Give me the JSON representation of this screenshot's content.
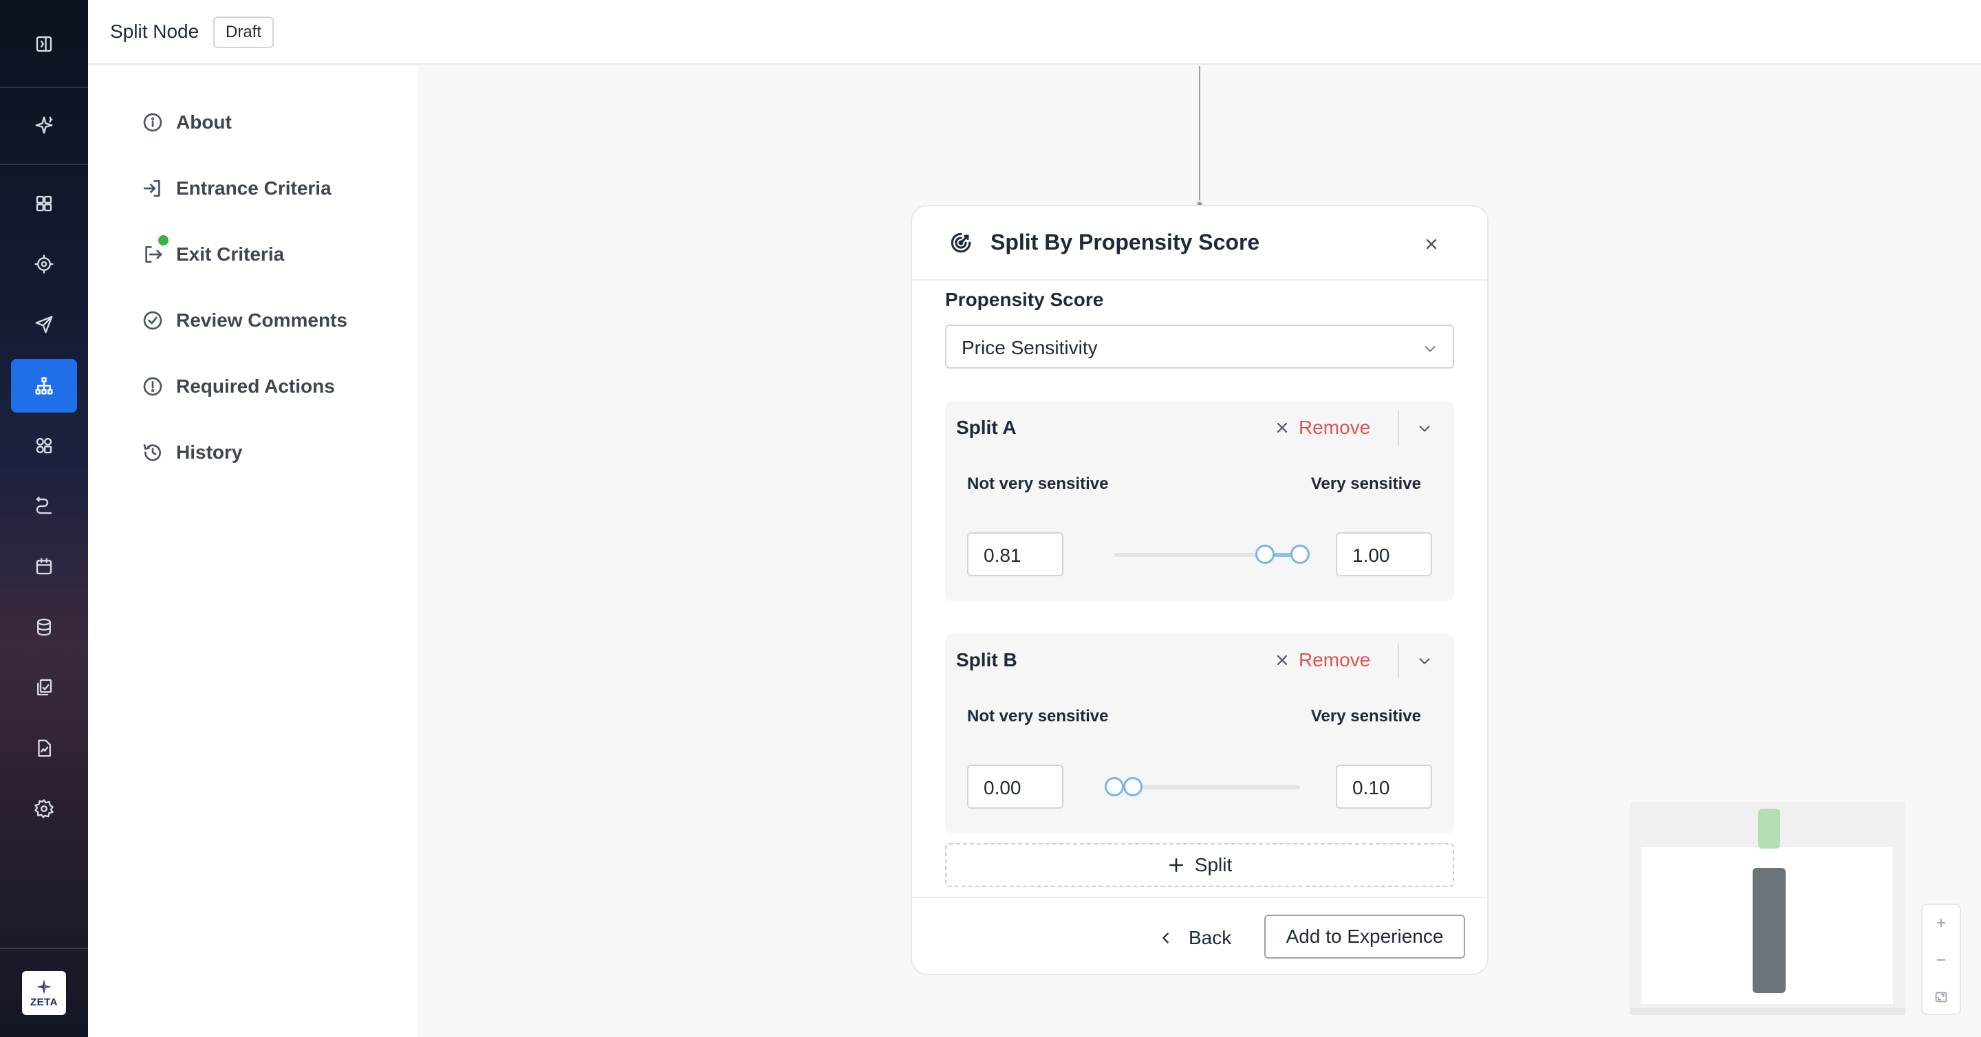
{
  "header": {
    "title": "Split Node",
    "badge": "Draft"
  },
  "rail": {
    "icons": [
      "sidebar-toggle-icon",
      "sparkle-icon",
      "dashboard-icon",
      "target-icon",
      "send-icon",
      "hierarchy-icon",
      "shapes-icon",
      "journey-icon",
      "calendar-icon",
      "database-icon",
      "library-icon",
      "report-icon",
      "settings-icon"
    ],
    "active": "hierarchy-icon",
    "logo_text": "ZETA",
    "accent": "#1f6fe8"
  },
  "sidenav": {
    "items": [
      {
        "label": "About",
        "icon": "info-icon"
      },
      {
        "label": "Entrance Criteria",
        "icon": "enter-icon",
        "status": "green-dot"
      },
      {
        "label": "Exit Criteria",
        "icon": "exit-icon"
      },
      {
        "label": "Review Comments",
        "icon": "check-circle-icon"
      },
      {
        "label": "Required Actions",
        "icon": "alert-circle-icon"
      },
      {
        "label": "History",
        "icon": "history-icon"
      }
    ]
  },
  "panel": {
    "title": "Split By Propensity Score",
    "field_label": "Propensity Score",
    "select_value": "Price Sensitivity",
    "splits": [
      {
        "name": "Split A",
        "remove_label": "Remove",
        "left_label": "Not very sensitive",
        "right_label": "Very sensitive",
        "min": "0.81",
        "max": "1.00",
        "range_min": 0.81,
        "range_max": 1.0
      },
      {
        "name": "Split B",
        "remove_label": "Remove",
        "left_label": "Not very sensitive",
        "right_label": "Very sensitive",
        "min": "0.00",
        "max": "0.10",
        "range_min": 0.0,
        "range_max": 0.1
      }
    ],
    "add_split_label": "Split",
    "back_label": "Back",
    "primary_label": "Add to Experience",
    "remove_color": "#e05252"
  },
  "zoom": {
    "controls": [
      "zoom-in-icon",
      "zoom-out-icon",
      "fit-view-icon"
    ]
  }
}
